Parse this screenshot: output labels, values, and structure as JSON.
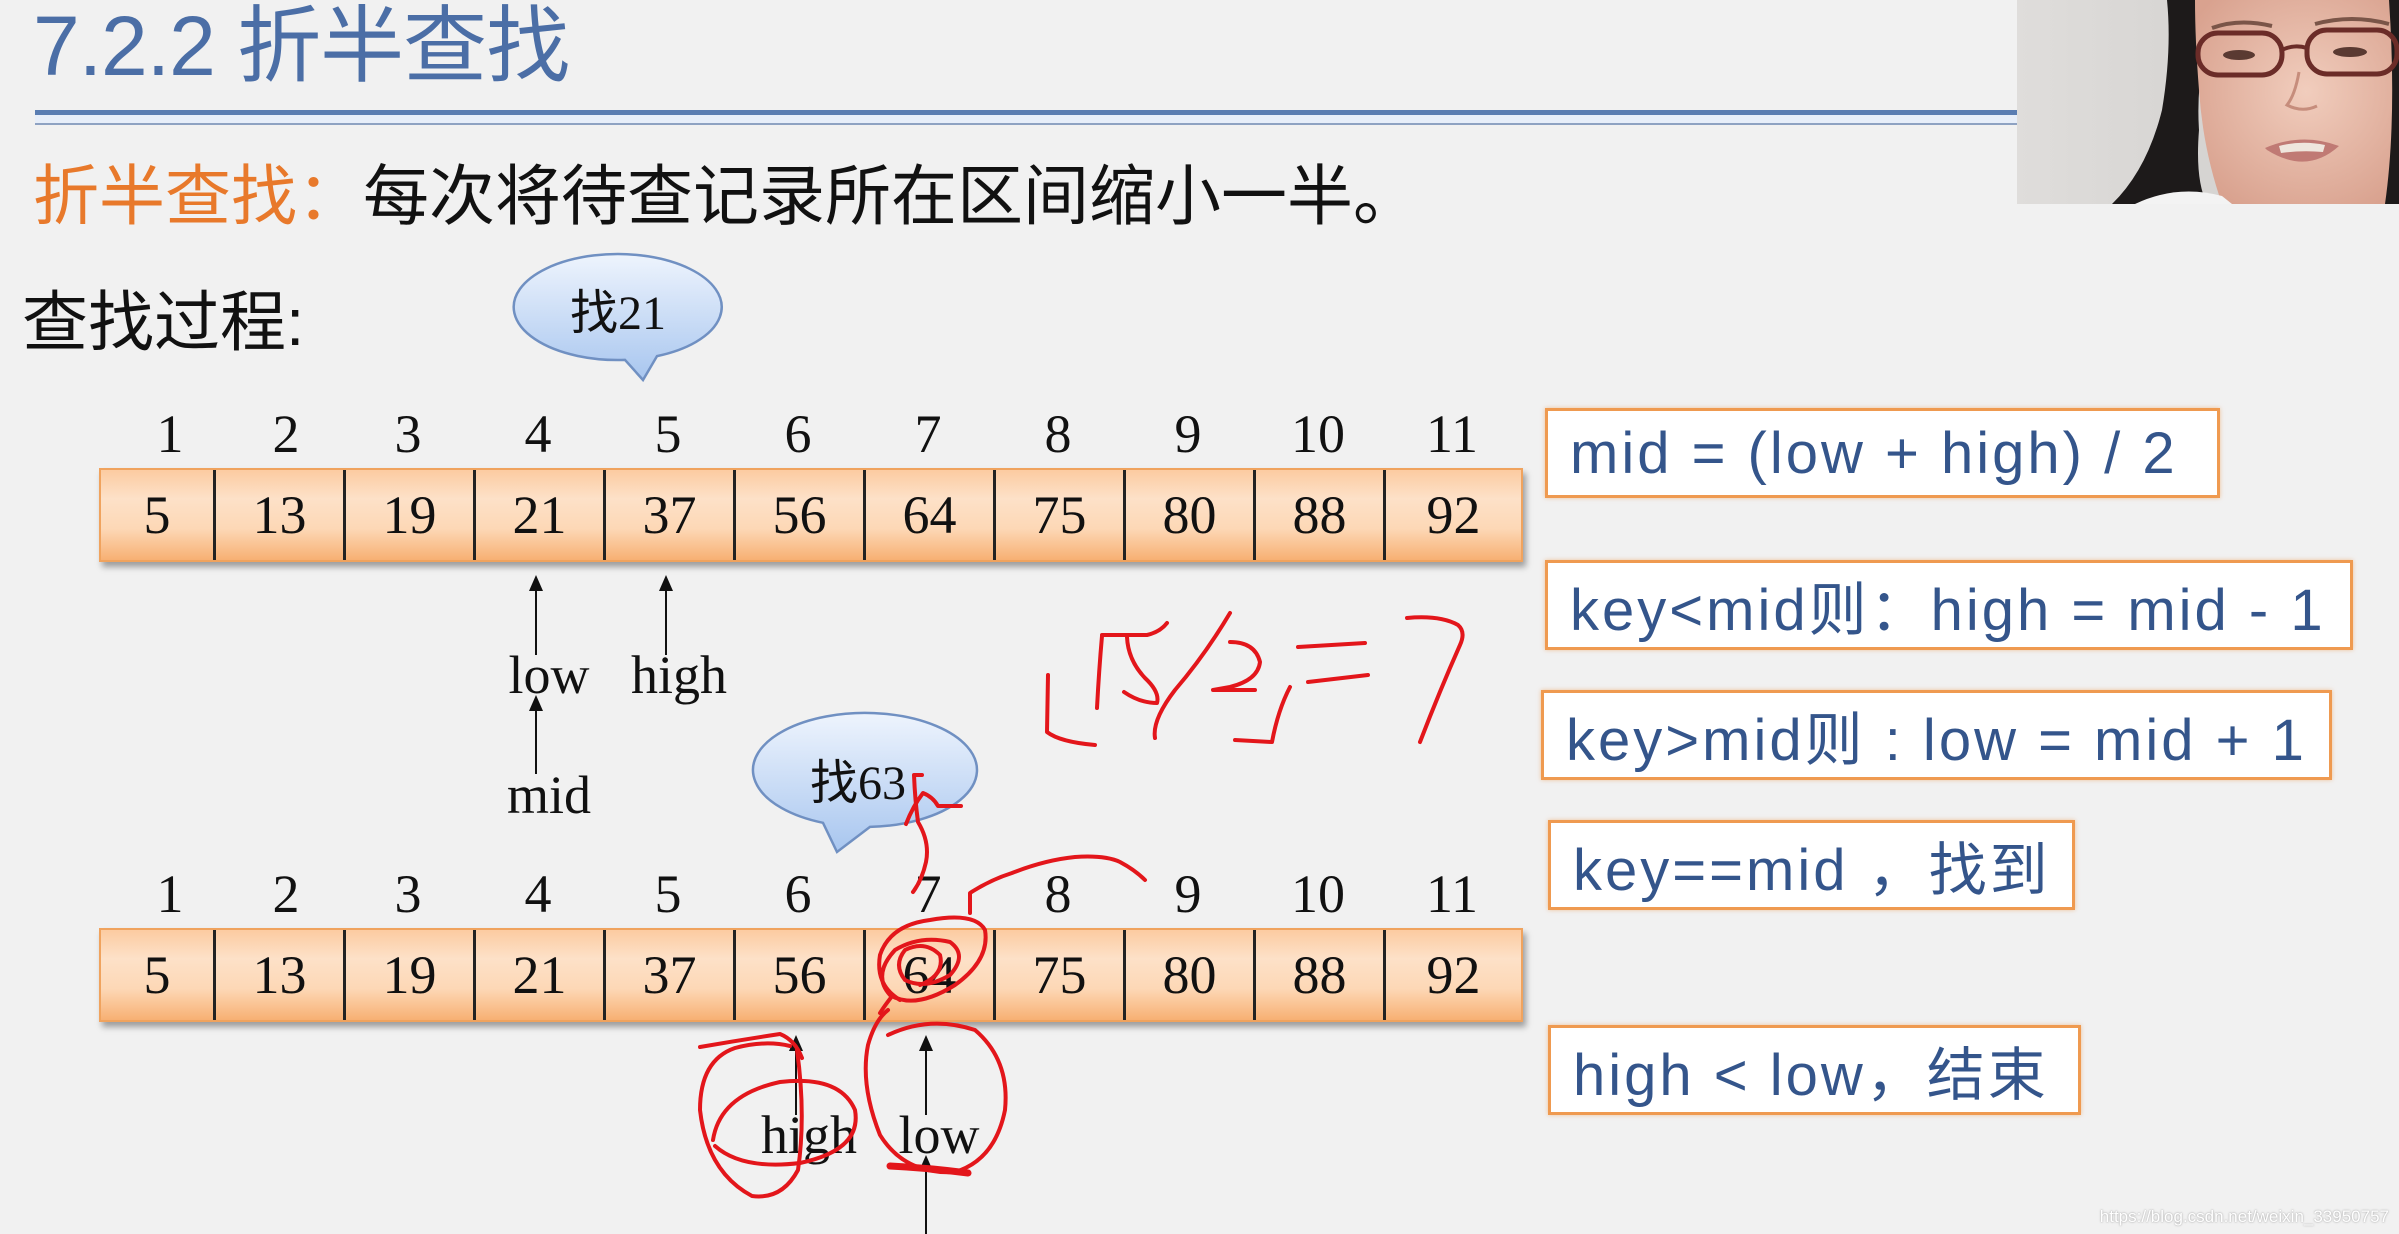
{
  "slide": {
    "title": "7.2.2 折半查找",
    "definition": {
      "term": "折半查找：",
      "text": "每次将待查记录所在区间缩小一半。"
    },
    "process_label": "查找过程:"
  },
  "theme": {
    "title_color": "#4b6ea6",
    "term_color": "#e8792b",
    "cell_fill_top": "#fccba1",
    "cell_fill_bottom": "#f7b073",
    "rule_border_color": "#ef9a50",
    "rule_text_color": "#34558b",
    "bubble_fill": "#a8c6ef",
    "annotation_color": "#e3161b"
  },
  "searches": [
    {
      "bubble": "找21",
      "indices": [
        1,
        2,
        3,
        4,
        5,
        6,
        7,
        8,
        9,
        10,
        11
      ],
      "values": [
        5,
        13,
        19,
        21,
        37,
        56,
        64,
        75,
        80,
        88,
        92
      ],
      "pointers": [
        {
          "label": "low",
          "index": 4
        },
        {
          "label": "high",
          "index": 5
        },
        {
          "label": "mid",
          "index": 4,
          "below": "low"
        }
      ]
    },
    {
      "bubble": "找63",
      "indices": [
        1,
        2,
        3,
        4,
        5,
        6,
        7,
        8,
        9,
        10,
        11
      ],
      "values": [
        5,
        13,
        19,
        21,
        37,
        56,
        64,
        75,
        80,
        88,
        92
      ],
      "pointers": [
        {
          "label": "high",
          "index": 6
        },
        {
          "label": "low",
          "index": 7
        },
        {
          "label": "",
          "index": 7,
          "below": "low"
        }
      ]
    }
  ],
  "rules": [
    "mid = (low + high) / 2",
    "key<mid则：high = mid - 1",
    "key>mid则 : low = mid + 1",
    "key==mid ，找到",
    "high < low，结束"
  ],
  "annotations": {
    "handwritten_formula": "⌊15/2⌋=7",
    "circled_items": [
      "64",
      "high",
      "low"
    ]
  },
  "webcam": {
    "subject": "lecturer"
  },
  "watermark": "https://blog.csdn.net/weixin_33950757"
}
